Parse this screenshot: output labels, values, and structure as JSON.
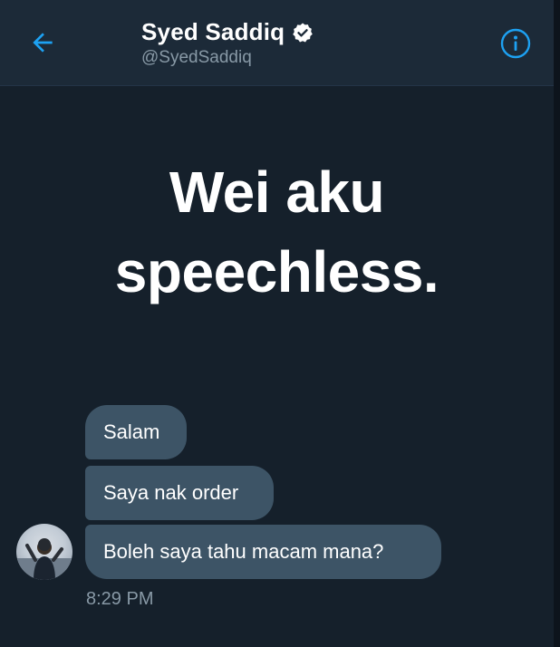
{
  "header": {
    "name": "Syed Saddiq",
    "handle": "@SyedSaddiq"
  },
  "caption": {
    "line1": "Wei aku",
    "line2": "speechless."
  },
  "messages": [
    {
      "text": "Salam"
    },
    {
      "text": "Saya nak order"
    },
    {
      "text": "Boleh saya tahu macam mana?"
    }
  ],
  "timestamp": "8:29 PM",
  "colors": {
    "background": "#15202b",
    "header": "#1c2a38",
    "accent": "#1da1f2",
    "bubble": "#3d5466",
    "muted": "#8899a6"
  },
  "icons": {
    "back": "back-arrow-icon",
    "verified": "verified-badge-icon",
    "info": "info-icon"
  }
}
